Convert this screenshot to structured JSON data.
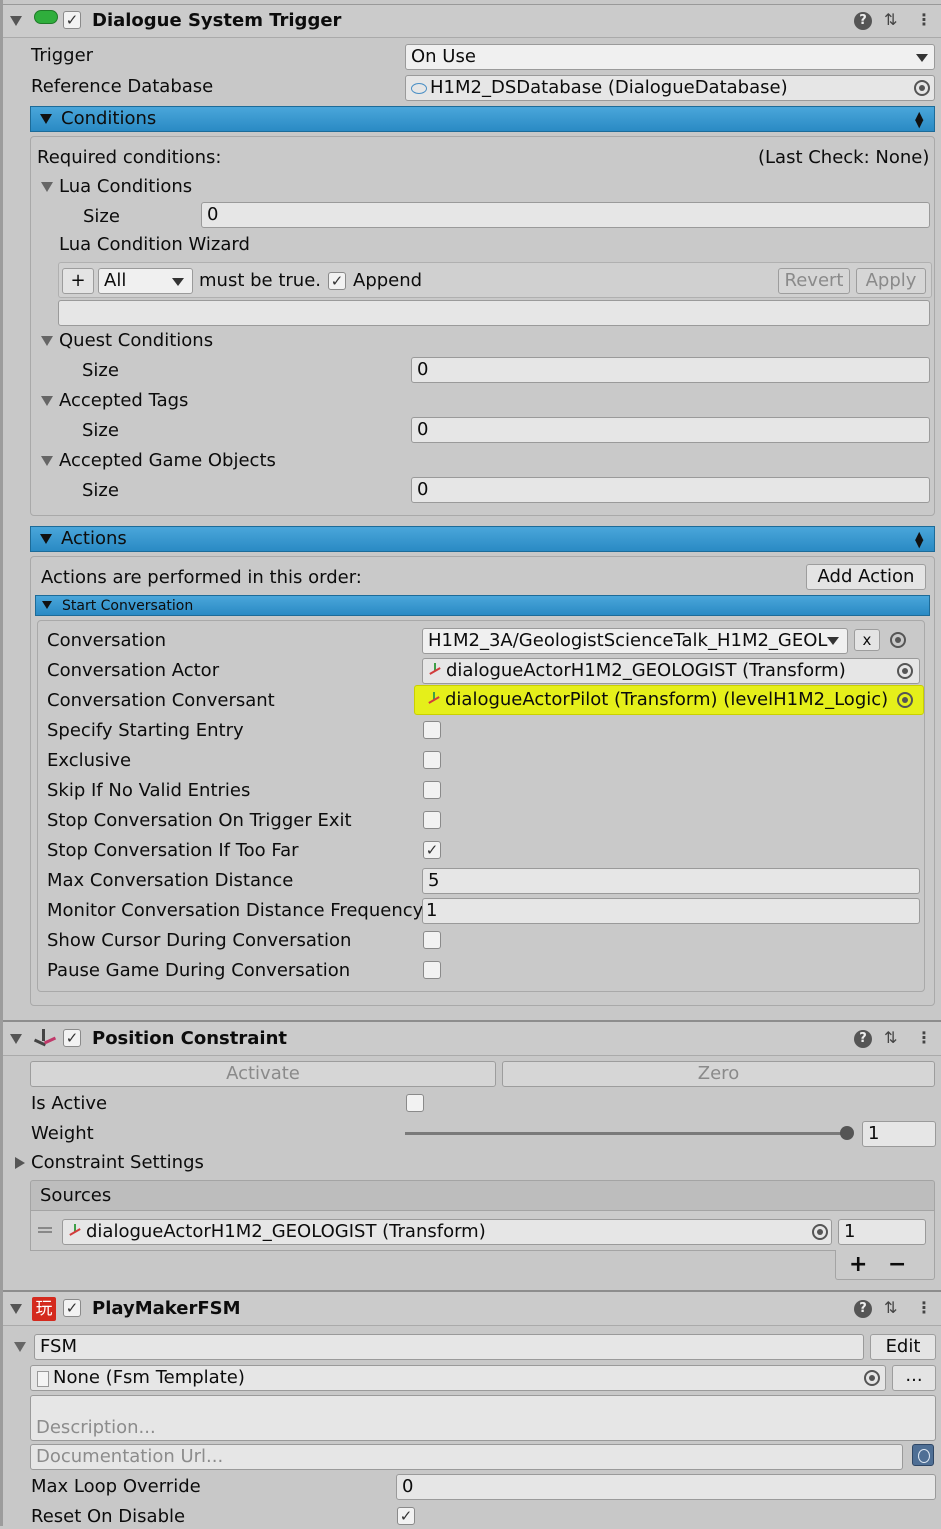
{
  "dst": {
    "title": "Dialogue System Trigger",
    "trigger_label": "Trigger",
    "trigger_value": "On Use",
    "refdb_label": "Reference Database",
    "refdb_value": "H1M2_DSDatabase (DialogueDatabase)",
    "conditions": {
      "header": "Conditions",
      "required": "Required conditions:",
      "last_check": "(Last Check: None)",
      "lua_conditions": "Lua Conditions",
      "size_label": "Size",
      "lua_size": "0",
      "wizard_label": "Lua Condition Wizard",
      "plus": "+",
      "all_value": "All",
      "must_be_true": "must be true.",
      "append": "Append",
      "revert": "Revert",
      "apply": "Apply",
      "quest_conditions": "Quest Conditions",
      "quest_size": "0",
      "accepted_tags": "Accepted Tags",
      "tags_size": "0",
      "accepted_game_objects": "Accepted Game Objects",
      "objects_size": "0"
    },
    "actions": {
      "header": "Actions",
      "order_text": "Actions are performed in this order:",
      "add_action": "Add Action",
      "start_conversation": "Start Conversation",
      "rows": {
        "conversation": "Conversation",
        "conversation_value": "H1M2_3A/GeologistScienceTalk_H1M2_GEOL",
        "clear": "x",
        "actor": "Conversation Actor",
        "actor_value": "dialogueActorH1M2_GEOLOGIST (Transform)",
        "conversant": "Conversation Conversant",
        "conversant_value": "dialogueActorPilot (Transform) (levelH1M2_Logic)",
        "specify_entry": "Specify Starting Entry",
        "exclusive": "Exclusive",
        "skip_invalid": "Skip If No Valid Entries",
        "stop_exit": "Stop Conversation On Trigger Exit",
        "stop_far": "Stop Conversation If Too Far",
        "max_distance": "Max Conversation Distance",
        "max_distance_value": "5",
        "monitor_freq": "Monitor Conversation Distance Frequency",
        "monitor_freq_value": "1",
        "show_cursor": "Show Cursor During Conversation",
        "pause_game": "Pause Game During Conversation"
      }
    }
  },
  "pc": {
    "title": "Position Constraint",
    "activate": "Activate",
    "zero": "Zero",
    "is_active": "Is Active",
    "weight": "Weight",
    "weight_value": "1",
    "weight_fraction": 1.0,
    "constraint_settings": "Constraint Settings",
    "sources": "Sources",
    "source_value": "dialogueActorH1M2_GEOLOGIST (Transform)",
    "source_weight": "1",
    "plus": "+",
    "minus": "−"
  },
  "fsm": {
    "title": "PlayMakerFSM",
    "logo": "玩",
    "name_value": "FSM",
    "edit": "Edit",
    "template_value": "None (Fsm Template)",
    "ellipsis": "...",
    "description_placeholder": "Description...",
    "docurl_placeholder": "Documentation Url...",
    "max_loop_label": "Max Loop Override",
    "max_loop_value": "0",
    "reset_label": "Reset On Disable"
  },
  "icons": {
    "help": "?",
    "settings": "⇅",
    "more": "⋮",
    "check": "✓"
  },
  "colors": {
    "blue_bar": "#2a8ac4",
    "highlight": "#e8f000"
  }
}
